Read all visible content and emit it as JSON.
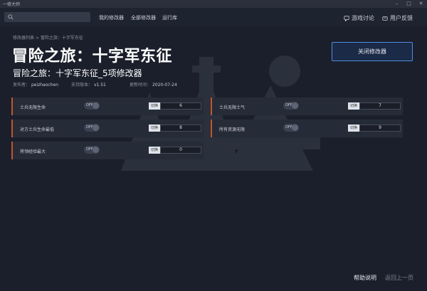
{
  "window": {
    "title": "一修大师"
  },
  "nav": {
    "search_placeholder": "",
    "items": [
      "我的修改器",
      "全部修改器",
      "运行库"
    ],
    "discuss": "游戏讨论",
    "feedback": "用户反馈"
  },
  "breadcrumb": "修改器列表 > 冒险之旅：十字军东征",
  "game": {
    "title": "冒险之旅：十字军东征",
    "subtitle": "冒险之旅：十字军东征_5项修改器",
    "publisher_label": "发布者：",
    "publisher": "peizhaochen",
    "version_label": "支持版本：",
    "version": "v1.51",
    "updated_label": "更新时间：",
    "updated": "2020-07-24"
  },
  "close_button": "关闭修改器",
  "cheats": [
    {
      "label": "士兵无限生命",
      "toggle": "OFF",
      "key_label": "切换",
      "value": "6"
    },
    {
      "label": "士兵无限士气",
      "toggle": "OFF",
      "key_label": "切换",
      "value": "7"
    },
    {
      "label": "对方士兵生命最低",
      "toggle": "OFF",
      "key_label": "切换",
      "value": "8"
    },
    {
      "label": "所有资源无限",
      "toggle": "OFF",
      "key_label": "切换",
      "value": "9"
    },
    {
      "label": "将领经验最大",
      "toggle": "OFF",
      "key_label": "切换",
      "value": "0"
    }
  ],
  "footer": {
    "help": "帮助说明",
    "back": "返回上一页"
  },
  "colors": {
    "accent": "#4e8de0",
    "card_edge": "#c3552c",
    "background": "#1b1f2b"
  }
}
